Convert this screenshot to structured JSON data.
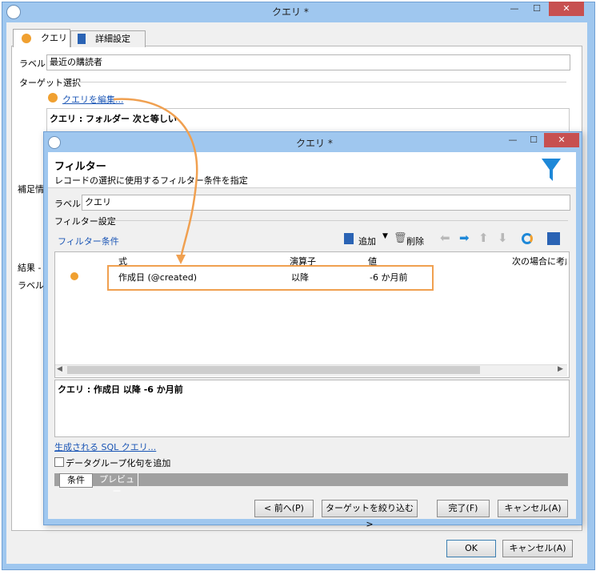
{
  "outer": {
    "title": "クエリ *",
    "minimize": "—",
    "maximize": "☐",
    "close": "✕",
    "tabs": [
      {
        "label": "クエリ"
      },
      {
        "label": "詳細設定"
      }
    ],
    "label_caption": "ラベル:",
    "label_value": "最近の購読者",
    "target_section": "ターゲット選択",
    "edit_query_link": "クエリを編集...",
    "query_summary": "クエリ : フォルダー 次と等しい",
    "partial_label_1": "補足情",
    "partial_label_2": "結果 -",
    "partial_label_3": "ラベル:",
    "ok_button": "OK",
    "cancel_button": "キャンセル(A)"
  },
  "inner": {
    "title": "クエリ *",
    "minimize": "—",
    "maximize": "☐",
    "close": "✕",
    "header_title": "フィルター",
    "header_subtitle": "レコードの選択に使用するフィルター条件を指定",
    "label_caption": "ラベル:",
    "label_value": "クエリ",
    "filter_settings": "フィルター設定",
    "filter_conditions_link": "フィルター条件",
    "toolbar": {
      "add": "追加",
      "delete": "削除"
    },
    "table": {
      "headers": [
        "式",
        "演算子",
        "値",
        "次の場合に考慮"
      ],
      "rows": [
        {
          "expression": "作成日 (@created)",
          "operator": "以降",
          "value": "-6 か月前"
        }
      ]
    },
    "query_text": "クエリ : 作成日 以降 -6 か月前",
    "sql_link": "生成される SQL クエリ...",
    "checkbox_label": "データグループ化句を追加",
    "bottom_tabs": [
      "条件",
      "プレビュー"
    ],
    "buttons": {
      "prev": "< 前へ(P)",
      "narrow": "ターゲットを絞り込む>",
      "finish": "完了(F)",
      "cancel": "キャンセル(A)"
    }
  },
  "colors": {
    "accent": "#f0a030",
    "titlebar": "#9fc7ef",
    "close_button": "#c75050",
    "link": "#1a55b5",
    "funnel": "#1e88d8"
  }
}
